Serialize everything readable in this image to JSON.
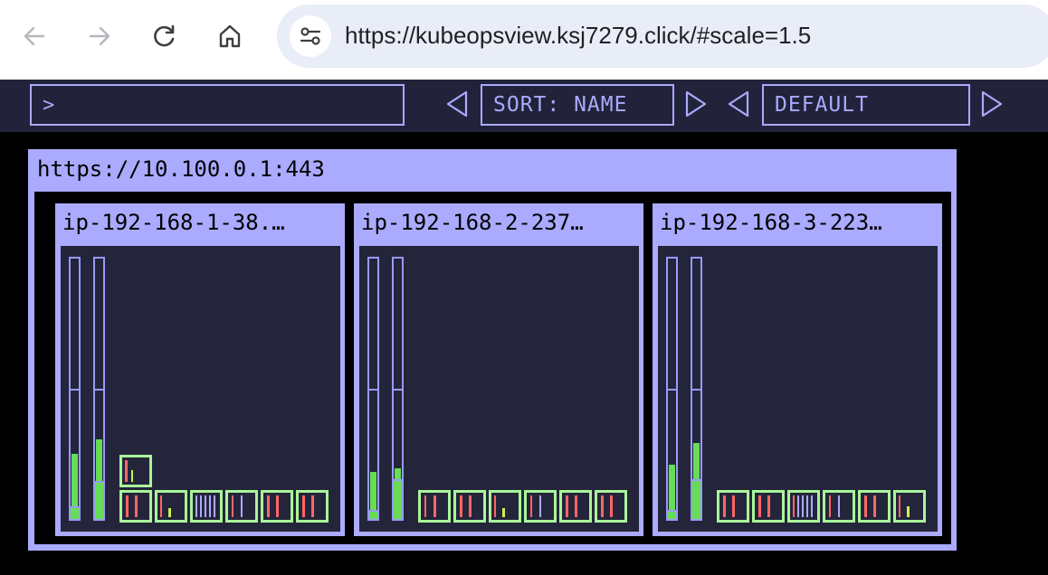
{
  "browser": {
    "url": "https://kubeopsview.ksj7279.click/#scale=1.5",
    "icons": [
      "back-arrow-icon",
      "forward-arrow-icon",
      "reload-icon",
      "home-icon",
      "site-info-icon"
    ]
  },
  "toolbar": {
    "filter_value": ">",
    "sort_label": "SORT: NAME",
    "theme_label": "DEFAULT"
  },
  "colors": {
    "accent": "#aaaaff",
    "background": "#000000",
    "panel": "#24253a",
    "pod_running": "#aaf59a",
    "usage_green": "#66dd55",
    "usage_red": "#ff6666"
  },
  "cluster": {
    "api_server_url": "https://10.100.0.1:443",
    "nodes": [
      {
        "name": "ip-192-168-1-38.…",
        "cpu_usage": 0.26,
        "memory_usage": 0.31,
        "pods": 7
      },
      {
        "name": "ip-192-168-2-237…",
        "cpu_usage": 0.18,
        "memory_usage": 0.19,
        "pods": 6
      },
      {
        "name": "ip-192-168-3-223…",
        "cpu_usage": 0.21,
        "memory_usage": 0.29,
        "pods": 6
      }
    ]
  }
}
